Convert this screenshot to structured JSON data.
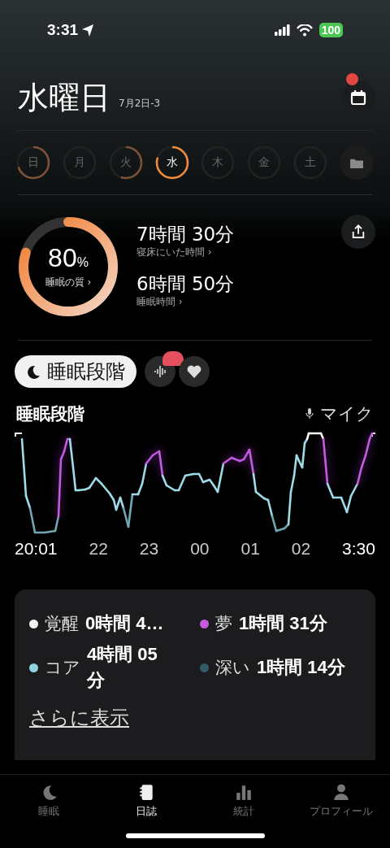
{
  "status_bar": {
    "time": "3:31",
    "battery": "100"
  },
  "header": {
    "title": "水曜日",
    "subtitle": "7月2日-3",
    "calendar_notification": true
  },
  "days": [
    {
      "label": "日",
      "selected": false
    },
    {
      "label": "月",
      "selected": false
    },
    {
      "label": "火",
      "selected": false
    },
    {
      "label": "水",
      "selected": true
    },
    {
      "label": "木",
      "selected": false
    },
    {
      "label": "金",
      "selected": false
    },
    {
      "label": "土",
      "selected": false
    }
  ],
  "summary": {
    "quality": {
      "value": "80",
      "unit": "%",
      "label": "睡眠の質 ›",
      "level": 0.8
    },
    "stats": [
      {
        "value": "7時間 30分",
        "label": "寝床にいた時間 ›"
      },
      {
        "value": "6時間 50分",
        "label": "睡眠時間 ›"
      }
    ]
  },
  "stage_tabs": [
    {
      "kind": "label",
      "label": "睡眠段階",
      "selected": true
    },
    {
      "kind": "sound",
      "selected": false,
      "badge": true
    },
    {
      "kind": "heart",
      "selected": false
    }
  ],
  "chart": {
    "title": "睡眠段階",
    "source": "マイク",
    "axis_labels": [
      "20:01",
      "22",
      "23",
      "00",
      "01",
      "02",
      "3:30"
    ]
  },
  "legend": [
    {
      "label": "覚醒",
      "value": "0時間 4…",
      "color": "#f2f2f2"
    },
    {
      "label": "夢",
      "value": "1時間 31分",
      "color": "#c45ce0"
    },
    {
      "label": "コア",
      "value": "4時間 05 分",
      "color": "#8fd3e0"
    },
    {
      "label": "深い",
      "value": "1時間 14分",
      "color": "#2f5a66"
    }
  ],
  "more_link": "さらに表示",
  "tab_bar": [
    {
      "label": "睡眠",
      "selected": false
    },
    {
      "label": "日誌",
      "selected": true
    },
    {
      "label": "統計",
      "selected": false
    },
    {
      "label": "プロフィール",
      "selected": false
    }
  ]
}
